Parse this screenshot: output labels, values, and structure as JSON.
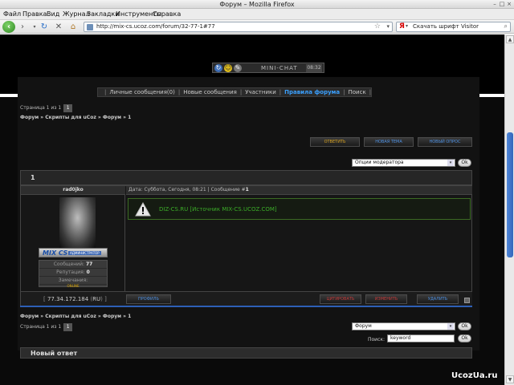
{
  "window": {
    "title": "Форум – Mozilla Firefox"
  },
  "menu": [
    "Файл",
    "Правка",
    "Вид",
    "Журнал",
    "Закладки",
    "Инструменты",
    "Справка"
  ],
  "url": "http://mix-cs.ucoz.com/forum/32-77-1#77",
  "search": {
    "value": "Скачать шрифт Visitor",
    "engine": "Я"
  },
  "minichat": {
    "label": "MINI-CHAT",
    "time": "08:32"
  },
  "navmenu": {
    "items": [
      "Личные сообщения(0)",
      "Новые сообщения",
      "Участники",
      "Правила форума",
      "Поиск"
    ],
    "active_index": 3
  },
  "pager": {
    "label": "Страница 1 из 1",
    "page": "1"
  },
  "breadcrumb": "Форум » Скрипты для uCoz » Форум » 1",
  "buttons": {
    "reply": "ОТВЕТИТЬ",
    "new_topic": "НОВАЯ ТЕМА",
    "new_poll": "НОВЫЙ ОПРОС"
  },
  "moderator_select": "Опции модератора",
  "ok": "Ok",
  "topic_title": "1",
  "post": {
    "author": "rad0jko",
    "rank_logo": "MIX CS",
    "rank_label": "АДМИНИСТРАТОР",
    "stats": {
      "messages_label": "Сообщений:",
      "messages": "77",
      "reputation_label": "Репутация:",
      "reputation": "0",
      "warnings_label": "Замечания:",
      "status": "ONLINE"
    },
    "date_label": "Дата: Суббота, Сегодня, 08:21",
    "message_label": "Сообщение #",
    "message_num": "1",
    "text": "DIZ-CS.RU [Источник MIX-CS.UCOZ.COM]",
    "ip": "77.34.172.184",
    "country": "RU",
    "profile_btn": "ПРОФИЛЬ",
    "quote_btn": "ЦИТИРОВАТЬ",
    "edit_btn": "ИЗМЕНИТЬ",
    "delete_btn": "УДАЛИТЬ"
  },
  "bottom": {
    "pager_label": "Страница 1 из 1",
    "page": "1",
    "breadcrumb": "Форум » Скрипты для uCoz » Форум » 1",
    "forum_select": "Форум",
    "search_label": "Поиск:",
    "search_value": "keyword"
  },
  "new_reply": "Новый ответ",
  "watermark": "UcozUa.ru"
}
